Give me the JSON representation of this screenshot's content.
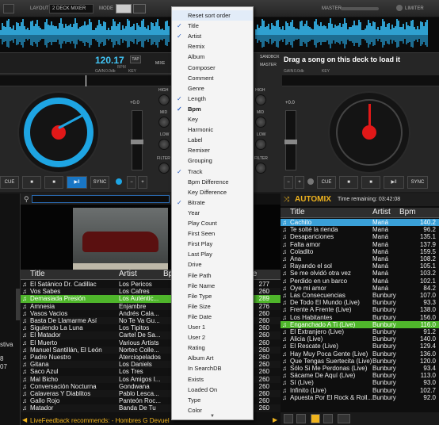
{
  "topbar": {
    "layout_label": "LAYOUT",
    "layout_value": "2 DECK MIXER",
    "mode_label": "MODE",
    "master_label": "MASTER",
    "limiter_label": "LIMITER"
  },
  "left_deck": {
    "bpm": "120.17",
    "bpm_unit": "BPM",
    "tap": "TAP",
    "gain_label": "GAIN",
    "gain_value": "0.0db",
    "key_label": "KEY",
    "pitch_value": "+0.0",
    "cue": "CUE",
    "sync": "SYNC"
  },
  "right_deck": {
    "sandbox": "SANDBOX",
    "master": "MASTER",
    "drag_hint": "Drag a song on this deck to load it",
    "gain_label": "GAIN",
    "gain_value": "0.0db",
    "key_label": "KEY",
    "pitch_value": "+0.0",
    "cue": "CUE",
    "sync": "SYNC"
  },
  "mixer": {
    "high": "HIGH",
    "mid": "MID",
    "low": "LOW",
    "filter": "FILTER",
    "mixer_tab": "MIXE"
  },
  "browser": {
    "columns": [
      "Title",
      "Artist",
      "Bp",
      "te"
    ],
    "rows": [
      {
        "title": "El Satánico Dr. Cadillac",
        "artist": "Los Pericos",
        "n": "277"
      },
      {
        "title": "Vos Sabes",
        "artist": "Los Cafres",
        "n": "260"
      },
      {
        "title": "Demasiada Presión",
        "artist": "Los Auténtic...",
        "n": "289"
      },
      {
        "title": "Amnesia",
        "artist": "Enjambre",
        "n": "276"
      },
      {
        "title": "Vasos Vacios",
        "artist": "Andrés Cala...",
        "n": "260"
      },
      {
        "title": "Basta De Llamarme Así",
        "artist": "No Te Va Gu...",
        "n": "260"
      },
      {
        "title": "Siguiendo La Luna",
        "artist": "Los Tipitos",
        "n": "260"
      },
      {
        "title": "El Matador",
        "artist": "Cartel De Sa...",
        "n": "260"
      },
      {
        "title": "El Muerto",
        "artist": "Various Artists",
        "n": "260"
      },
      {
        "title": "Manuel Santillán, El León",
        "artist": "Nortec Colle...",
        "n": "260"
      },
      {
        "title": "Padre Nuestro",
        "artist": "Aterciopelados",
        "n": "260"
      },
      {
        "title": "Gitana",
        "artist": "Los Daniels",
        "n": "260"
      },
      {
        "title": "Saco Azul",
        "artist": "Los Tres",
        "n": "260"
      },
      {
        "title": "Mal Bicho",
        "artist": "Los Amigos I...",
        "n": "260"
      },
      {
        "title": "Conversación Nocturna",
        "artist": "Gondwana",
        "n": "260"
      },
      {
        "title": "Calaveras Y Diablitos",
        "artist": "Pablo Lesca...",
        "n": "260"
      },
      {
        "title": "Gallo Rojo",
        "artist": "Panteón Roc...",
        "n": "260"
      },
      {
        "title": "Matador",
        "artist": "Banda De Tu",
        "n": "260"
      }
    ],
    "live_feedback": "LiveFeedback recommends:  - Hombres G  Devuel"
  },
  "left_edge": {
    "items": [
      "stiva",
      "8",
      "07"
    ]
  },
  "automix": {
    "title": "AUTOMIX",
    "remaining": "Time remaining: 03:42:08",
    "columns": [
      "Title",
      "Artist",
      "Bpm"
    ],
    "rows": [
      {
        "title": "Cachito",
        "artist": "Maná",
        "bpm": "140.2"
      },
      {
        "title": "Te solté la rienda",
        "artist": "Maná",
        "bpm": "96.2"
      },
      {
        "title": "Desapariciones",
        "artist": "Maná",
        "bpm": "135.1"
      },
      {
        "title": "Falta amor",
        "artist": "Maná",
        "bpm": "137.9"
      },
      {
        "title": "Coladito",
        "artist": "Maná",
        "bpm": "159.5"
      },
      {
        "title": "Ana",
        "artist": "Maná",
        "bpm": "108.2"
      },
      {
        "title": "Rayando el sol",
        "artist": "Maná",
        "bpm": "105.1"
      },
      {
        "title": "Se me olvidó otra vez",
        "artist": "Maná",
        "bpm": "103.2"
      },
      {
        "title": "Perdido en un barco",
        "artist": "Maná",
        "bpm": "102.1"
      },
      {
        "title": "Oye mi amor",
        "artist": "Maná",
        "bpm": "84.2"
      },
      {
        "title": "Las Consecuencias",
        "artist": "Bunbury",
        "bpm": "107.0"
      },
      {
        "title": "De Todo El Mundo (Live)",
        "artist": "Bunbury",
        "bpm": "93.3"
      },
      {
        "title": "Frente A Frente (Live)",
        "artist": "Bunbury",
        "bpm": "138.0"
      },
      {
        "title": "Los Habitantes",
        "artist": "Bunbury",
        "bpm": "156.0"
      },
      {
        "title": "Enganchado A Ti (Live)",
        "artist": "Bunbury",
        "bpm": "116.0"
      },
      {
        "title": "El Extranjero (Live)",
        "artist": "Bunbury",
        "bpm": "91.2"
      },
      {
        "title": "Alicia (Live)",
        "artist": "Bunbury",
        "bpm": "140.0"
      },
      {
        "title": "El Rescate (Live)",
        "artist": "Bunbury",
        "bpm": "129.4"
      },
      {
        "title": "Hay Muy Poca Gente (Live)",
        "artist": "Bunbury",
        "bpm": "136.0"
      },
      {
        "title": "Que Tengas Suertecita (Live)",
        "artist": "Bunbury",
        "bpm": "120.0"
      },
      {
        "title": "Sólo Si Me Perdonas (Live)",
        "artist": "Bunbury",
        "bpm": "93.4"
      },
      {
        "title": "Sácame De Aquí (Live)",
        "artist": "Bunbury",
        "bpm": "113.0"
      },
      {
        "title": "Sí (Live)",
        "artist": "Bunbury",
        "bpm": "93.0"
      },
      {
        "title": "Infinito (Live)",
        "artist": "Bunbury",
        "bpm": "102.7"
      },
      {
        "title": "Apuesta Por El Rock & Roll...",
        "artist": "Bunbury",
        "bpm": "92.0"
      }
    ]
  },
  "context_menu": {
    "items": [
      {
        "label": "Reset sort order",
        "checked": false
      },
      {
        "label": "Title",
        "checked": true
      },
      {
        "label": "Artist",
        "checked": true
      },
      {
        "label": "Remix",
        "checked": false
      },
      {
        "label": "Album",
        "checked": false
      },
      {
        "label": "Composer",
        "checked": false
      },
      {
        "label": "Comment",
        "checked": false
      },
      {
        "label": "Genre",
        "checked": false
      },
      {
        "label": "Length",
        "checked": true
      },
      {
        "label": "Bpm",
        "checked": true
      },
      {
        "label": "Key",
        "checked": false
      },
      {
        "label": "Harmonic",
        "checked": false
      },
      {
        "label": "Label",
        "checked": false
      },
      {
        "label": "Remixer",
        "checked": false
      },
      {
        "label": "Grouping",
        "checked": false
      },
      {
        "label": "Track",
        "checked": true
      },
      {
        "label": "Bpm Difference",
        "checked": false
      },
      {
        "label": "Key Difference",
        "checked": false
      },
      {
        "label": "Bitrate",
        "checked": true
      },
      {
        "label": "Year",
        "checked": false
      },
      {
        "label": "Play Count",
        "checked": false
      },
      {
        "label": "First Seen",
        "checked": false
      },
      {
        "label": "First Play",
        "checked": false
      },
      {
        "label": "Last Play",
        "checked": false
      },
      {
        "label": "Drive",
        "checked": false
      },
      {
        "label": "File Path",
        "checked": false
      },
      {
        "label": "File Name",
        "checked": false
      },
      {
        "label": "File Type",
        "checked": false
      },
      {
        "label": "File Size",
        "checked": false
      },
      {
        "label": "File Date",
        "checked": false
      },
      {
        "label": "User 1",
        "checked": false
      },
      {
        "label": "User 2",
        "checked": false
      },
      {
        "label": "Rating",
        "checked": false
      },
      {
        "label": "Album Art",
        "checked": false
      },
      {
        "label": "In SearchDB",
        "checked": false
      },
      {
        "label": "Exists",
        "checked": false
      },
      {
        "label": "Loaded On",
        "checked": false
      },
      {
        "label": "Type",
        "checked": false
      },
      {
        "label": "Color",
        "checked": false
      }
    ]
  },
  "colors": {
    "accent_blue": "#1ea5e3",
    "selected_green": "#4fb62b",
    "automix_yellow": "#f0b41e",
    "platter_red": "#e11818"
  }
}
